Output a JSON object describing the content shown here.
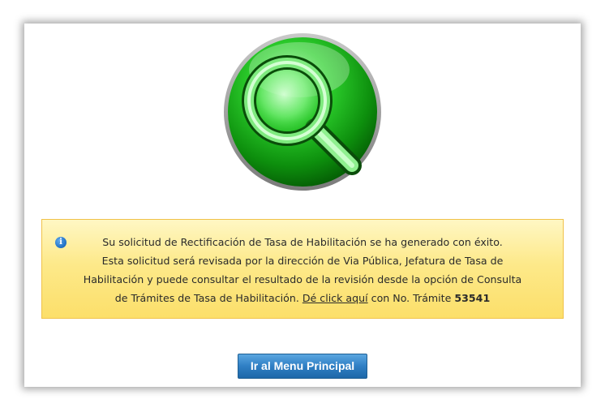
{
  "message": {
    "line1": "Su solicitud de Rectificación de Tasa de Habilitación se ha generado con éxito.",
    "line2": "Esta solicitud será revisada por la dirección de Via Pública, Jefatura de Tasa de",
    "line3": "Habilitación y puede consultar el resultado de la revisión desde la opción de Consulta",
    "line4_prefix": "de Trámites de Tasa de Habilitación.",
    "link_text": "Dé click aquí",
    "line4_middle": "con No. Trámite",
    "tramite_number": "53541"
  },
  "button": {
    "label": "Ir al Menu Principal"
  },
  "icons": {
    "main": "magnifying-glass-icon",
    "info": "info-icon"
  },
  "colors": {
    "success_green": "#1fae1f",
    "info_background": "#fde98a",
    "button_blue": "#2f7fc4"
  }
}
